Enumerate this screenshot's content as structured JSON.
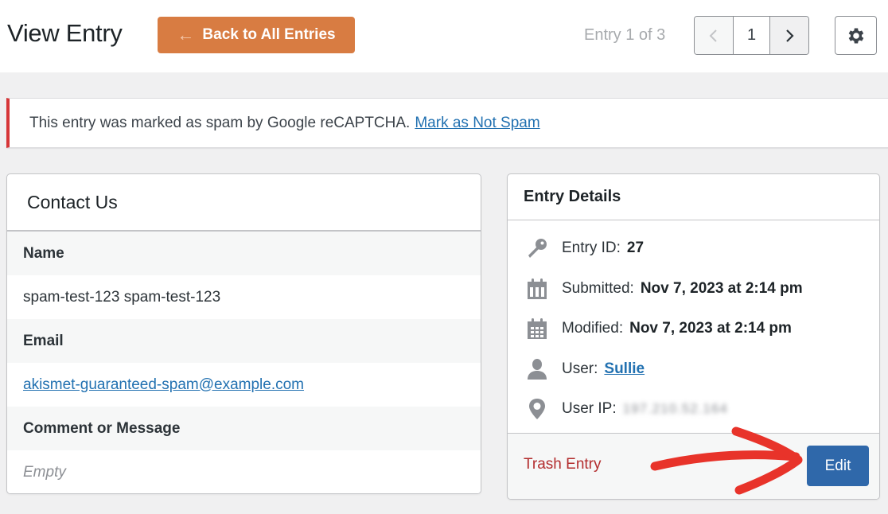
{
  "header": {
    "title": "View Entry",
    "back_button": {
      "icon": "arrow-left-icon",
      "label": "Back to All Entries",
      "color": "#d87c42"
    },
    "entry_count": "Entry 1 of 3",
    "pagination": {
      "current_page": "1",
      "prev_icon": "chevron-left-icon",
      "next_icon": "chevron-right-icon"
    },
    "settings_icon": "gear-icon"
  },
  "notice": {
    "message": "This entry was marked as spam by Google reCAPTCHA.",
    "link_label": "Mark as Not Spam",
    "accent_color": "#d63638"
  },
  "form": {
    "title": "Contact Us",
    "fields": [
      {
        "label": "Name",
        "value": "spam-test-123 spam-test-123",
        "type": "text"
      },
      {
        "label": "Email",
        "value": "akismet-guaranteed-spam@example.com",
        "type": "link"
      },
      {
        "label": "Comment or Message",
        "value": "Empty",
        "type": "empty"
      }
    ]
  },
  "details": {
    "title": "Entry Details",
    "rows": [
      {
        "icon": "key-icon",
        "label": "Entry ID:",
        "value": "27"
      },
      {
        "icon": "calendar-icon",
        "label": "Submitted:",
        "value": "Nov 7, 2023 at 2:14 pm"
      },
      {
        "icon": "calendar-grid-icon",
        "label": "Modified:",
        "value": "Nov 7, 2023 at 2:14 pm"
      },
      {
        "icon": "user-icon",
        "label": "User:",
        "value": "Sullie"
      },
      {
        "icon": "location-pin-icon",
        "label": "User IP:",
        "value": "197.210.52.164"
      }
    ],
    "trash_label": "Trash Entry",
    "edit_label": "Edit",
    "edit_color": "#2f68aa",
    "annotation": {
      "icon": "red-arrow-annotation",
      "color": "#e8332a"
    }
  }
}
